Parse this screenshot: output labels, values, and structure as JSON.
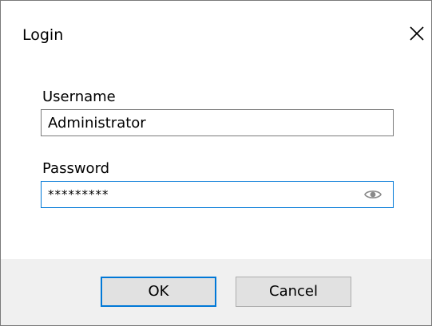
{
  "dialog": {
    "title": "Login",
    "close_icon": "close-icon"
  },
  "form": {
    "username_label": "Username",
    "username_value": "Administrator",
    "password_label": "Password",
    "password_value": "*********",
    "reveal_icon": "eye-icon"
  },
  "buttons": {
    "ok_label": "OK",
    "cancel_label": "Cancel"
  },
  "colors": {
    "focus_border": "#0078d7",
    "field_border": "#7a7a7a",
    "footer_background": "#f0f0f0",
    "button_background": "#e1e1e1"
  }
}
